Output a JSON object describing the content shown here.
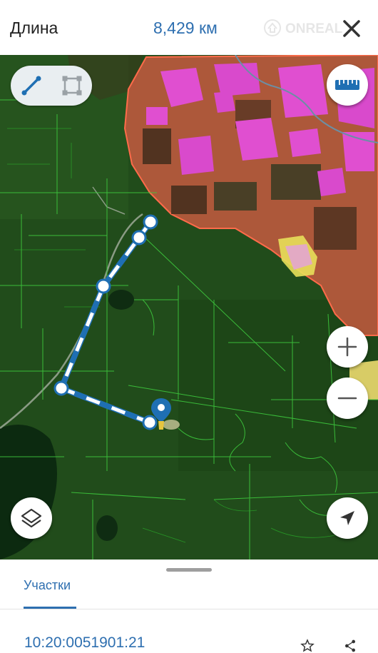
{
  "header": {
    "title": "Длина",
    "length_value": "8,429 км",
    "watermark": "ONREAL",
    "close_icon": "close-icon"
  },
  "map": {
    "accent_color": "#1f6fb3",
    "route_points_count": 6,
    "draw_modes": [
      "line-icon",
      "polygon-icon"
    ],
    "controls": [
      "ruler-icon",
      "zoom-in-icon",
      "zoom-out-icon",
      "layers-icon",
      "locate-icon"
    ]
  },
  "bottom_sheet": {
    "tab_label": "Участки",
    "parcel_id": "10:20:0051901:21",
    "row_icons": [
      "star-icon",
      "share-icon"
    ]
  }
}
